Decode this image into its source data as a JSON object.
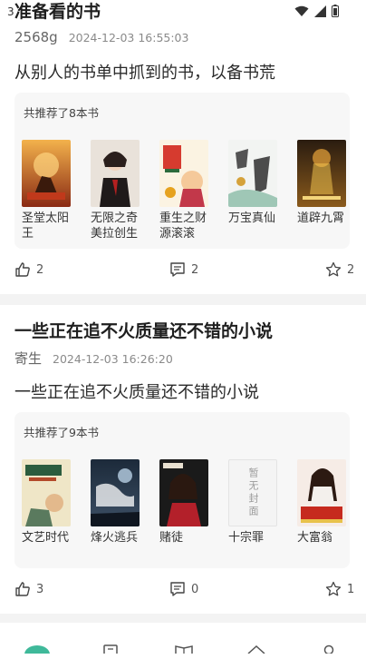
{
  "status": {
    "time": "3"
  },
  "feed": [
    {
      "title": "准备看的书",
      "author": "2568g",
      "date": "2024-12-03 16:55:03",
      "description": "从别人的书单中抓到的书，以备书荒",
      "count_label": "共推荐了8本书",
      "books": [
        "圣堂太阳王",
        "无限之奇美拉创生",
        "重生之财源滚滚",
        "万宝真仙",
        "道辟九霄"
      ],
      "likes": "2",
      "comments": "2",
      "favorites": "2"
    },
    {
      "title": "一些正在追不火质量还不错的小说",
      "author": "寄生",
      "date": "2024-12-03 16:26:20",
      "description": "一些正在追不火质量还不错的小说",
      "count_label": "共推荐了9本书",
      "books": [
        "文艺时代",
        "烽火逃兵",
        "赌徒",
        "十宗罪",
        "大富翁"
      ],
      "likes": "3",
      "comments": "0",
      "favorites": "1"
    }
  ],
  "covers": {
    "no_cover_text": "暂无封面"
  },
  "icons": {
    "like": "thumb-up-icon",
    "comment": "comment-icon",
    "favorite": "star-icon"
  },
  "colors": {
    "page_bg": "#f3f3f3",
    "card_bg": "#ffffff",
    "panel_bg": "#f7f7f7",
    "text_primary": "#1e1e1e",
    "text_secondary": "#8a8a8a"
  }
}
